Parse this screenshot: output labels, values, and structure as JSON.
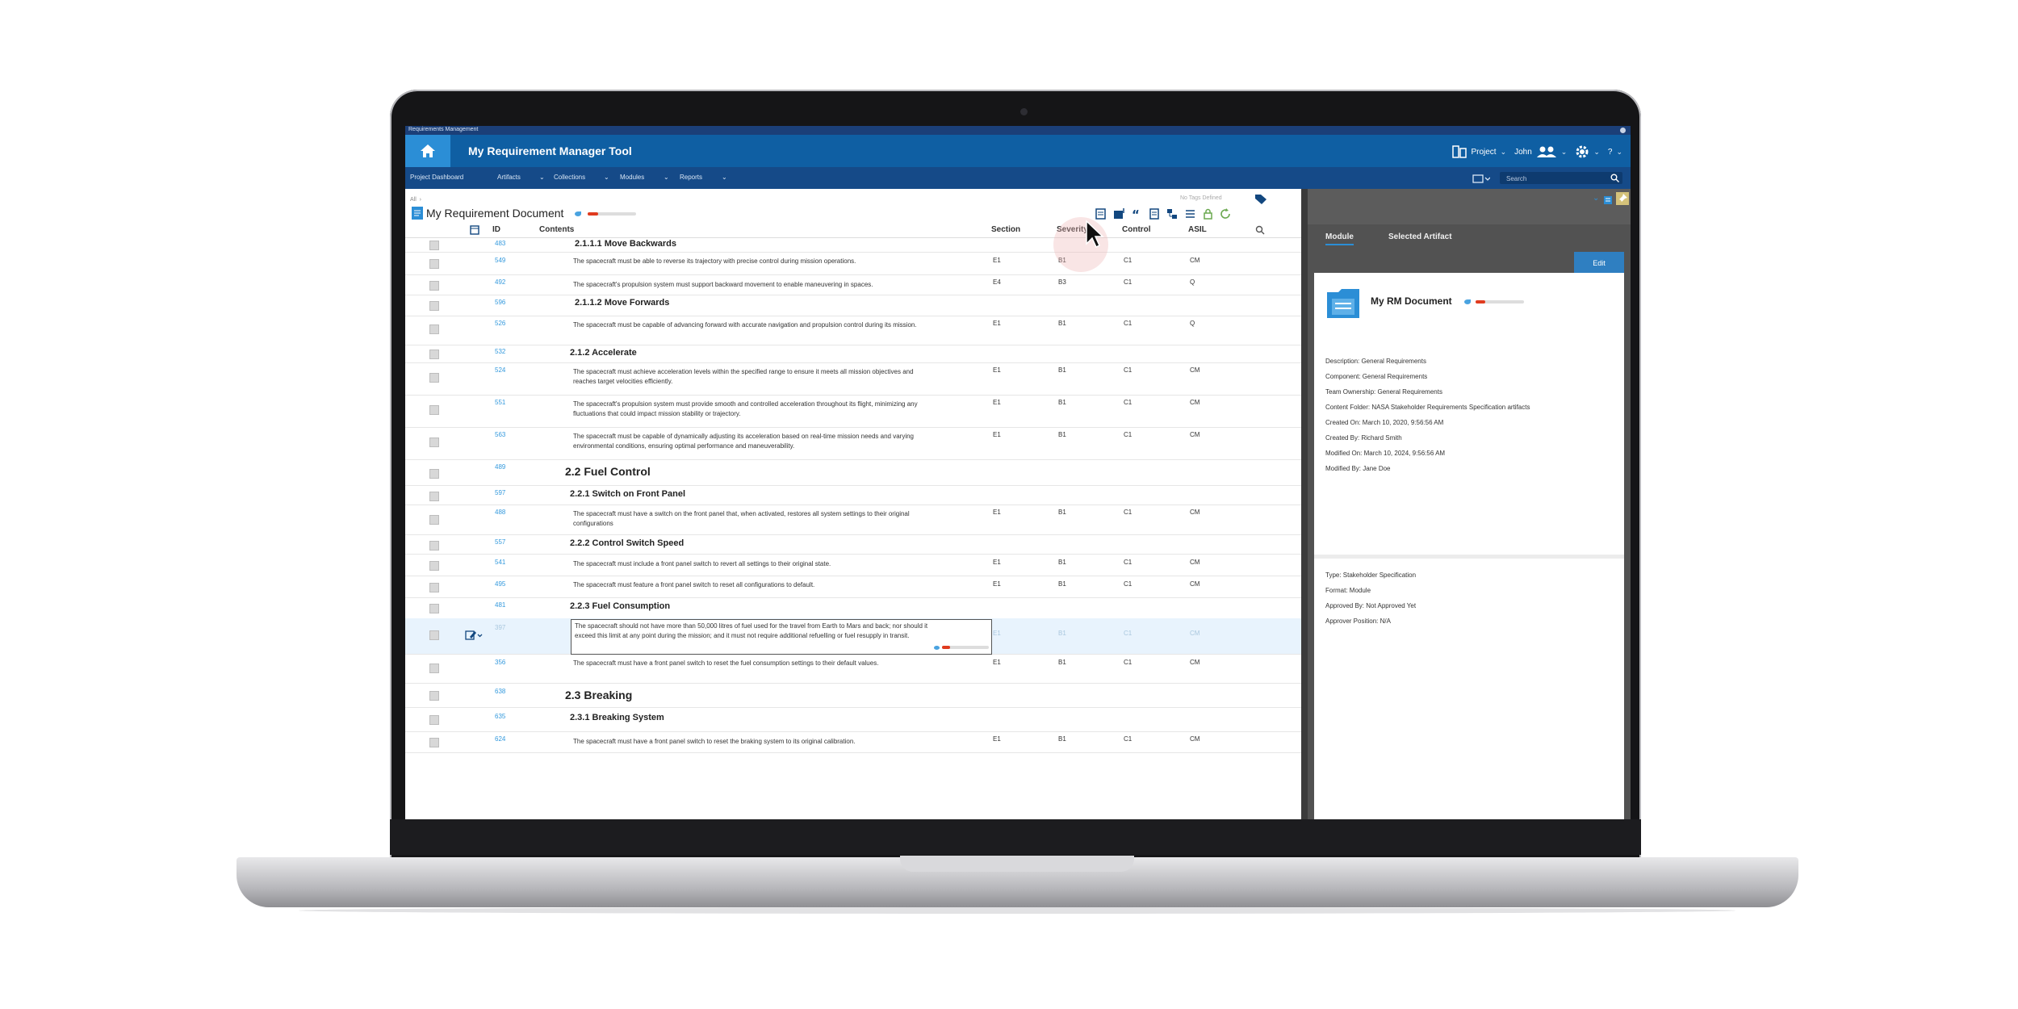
{
  "window": {
    "title": "Requirements Management"
  },
  "app": {
    "title": "My Requirement Manager Tool"
  },
  "header": {
    "project": "Project",
    "user": "John",
    "help": "?"
  },
  "nav": {
    "dashboard": "Project Dashboard",
    "artifacts": "Artifacts",
    "collections": "Collections",
    "modules": "Modules",
    "reports": "Reports",
    "search_placeholder": "Search"
  },
  "document": {
    "breadcrumb": "All",
    "title": "My Requirement Document",
    "tags_label": "No Tags Defined",
    "progress": 0.22
  },
  "table": {
    "columns": {
      "id": "ID",
      "contents": "Contents",
      "section": "Section",
      "severity": "Severity",
      "control": "Control",
      "asil": "ASIL"
    },
    "rows": [
      {
        "id": "483",
        "heading": "2.1.1.1 Move Backwards"
      },
      {
        "id": "549",
        "text": "The spacecraft must be able to reverse its trajectory with precise control during mission operations.",
        "section": "E1",
        "severity": "B1",
        "control": "C1",
        "asil": "CM"
      },
      {
        "id": "492",
        "text": "The spacecraft's propulsion system must support backward movement to enable maneuvering in spaces.",
        "section": "E4",
        "severity": "B3",
        "control": "C1",
        "asil": "Q"
      },
      {
        "id": "596",
        "heading": "2.1.1.2 Move Forwards"
      },
      {
        "id": "526",
        "text": "The spacecraft must be capable of advancing forward with accurate navigation and propulsion control during its mission.",
        "section": "E1",
        "severity": "B1",
        "control": "C1",
        "asil": "Q"
      },
      {
        "id": "532",
        "heading": "2.1.2 Accelerate"
      },
      {
        "id": "524",
        "text": "The spacecraft must achieve acceleration levels within the specified range to ensure it meets all mission objectives and reaches target velocities efficiently.",
        "section": "E1",
        "severity": "B1",
        "control": "C1",
        "asil": "CM"
      },
      {
        "id": "551",
        "text": "The spacecraft's propulsion system must provide smooth and controlled acceleration throughout its flight, minimizing any fluctuations that could impact mission stability or trajectory.",
        "section": "E1",
        "severity": "B1",
        "control": "C1",
        "asil": "CM"
      },
      {
        "id": "563",
        "text": "The spacecraft must be capable of dynamically adjusting its acceleration based on real-time mission needs and varying environmental conditions, ensuring optimal performance and maneuverability.",
        "section": "E1",
        "severity": "B1",
        "control": "C1",
        "asil": "CM"
      },
      {
        "id": "489",
        "heading": "2.2 Fuel Control"
      },
      {
        "id": "597",
        "heading": "2.2.1 Switch on Front Panel"
      },
      {
        "id": "488",
        "text": "The spacecraft must have a switch on the front panel that, when activated, restores all system settings to their original configurations",
        "section": "E1",
        "severity": "B1",
        "control": "C1",
        "asil": "CM"
      },
      {
        "id": "557",
        "heading": "2.2.2 Control Switch Speed"
      },
      {
        "id": "541",
        "text": "The spacecraft must include a front panel switch to revert all settings to their original state.",
        "section": "E1",
        "severity": "B1",
        "control": "C1",
        "asil": "CM"
      },
      {
        "id": "495",
        "text": "The spacecraft must feature a front panel switch to reset all configurations to default.",
        "section": "E1",
        "severity": "B1",
        "control": "C1",
        "asil": "CM"
      },
      {
        "id": "481",
        "heading": "2.2.3 Fuel Consumption"
      },
      {
        "id": "397",
        "text": "The spacecraft should not have more than 50,000 litres of fuel used for the travel from Earth to Mars and back; nor should it exceed this limit at any point during the mission; and it must not require additional refuelling or fuel resupply in transit.",
        "section": "E1",
        "severity": "B1",
        "control": "C1",
        "asil": "CM"
      },
      {
        "id": "356",
        "text": "The spacecraft must have a front panel switch to reset the fuel consumption settings to their default values.",
        "section": "E1",
        "severity": "B1",
        "control": "C1",
        "asil": "CM"
      },
      {
        "id": "638",
        "heading": "2.3 Breaking"
      },
      {
        "id": "635",
        "heading": "2.3.1 Breaking System"
      },
      {
        "id": "624",
        "text": "The spacecraft must have a front panel switch to reset the braking system to its original calibration.",
        "section": "E1",
        "severity": "B1",
        "control": "C1",
        "asil": "CM"
      }
    ]
  },
  "side_panel": {
    "tabs": {
      "module": "Module",
      "selected_artifact": "Selected Artifact"
    },
    "edit_label": "Edit",
    "title": "My RM Document",
    "progress": 0.2,
    "meta": [
      "Description: General Requirements",
      "Component: General Requirements",
      "Team Ownership: General Requirements",
      "Content Folder: NASA Stakeholder Requirements Specification artifacts",
      "Created On: March 10, 2020, 9:56:56 AM",
      "Created By: Richard Smith",
      "Modified On: March 10, 2024, 9:56:56 AM",
      "Modified By: Jane Doe"
    ],
    "meta2": [
      "Type: Stakeholder Specification",
      "Format: Module",
      "Approved By: Not Approved Yet",
      "Approver Position: N/A"
    ]
  }
}
